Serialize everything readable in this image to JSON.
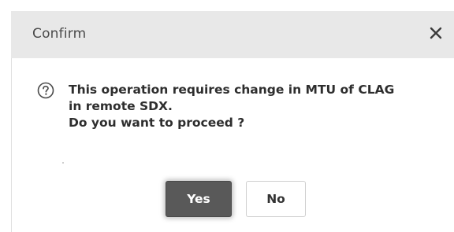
{
  "dialog": {
    "title": "Confirm",
    "close_icon": "close-icon",
    "message_lines": [
      "This operation requires change in MTU of CLAG",
      "in remote SDX.",
      "Do you want to proceed ?"
    ],
    "question_icon": "question-circle-icon",
    "buttons": {
      "yes_label": "Yes",
      "no_label": "No"
    }
  },
  "colors": {
    "header_bg": "#e8e8e8",
    "primary_button": "#595959",
    "secondary_button_border": "#cfcfcf"
  }
}
